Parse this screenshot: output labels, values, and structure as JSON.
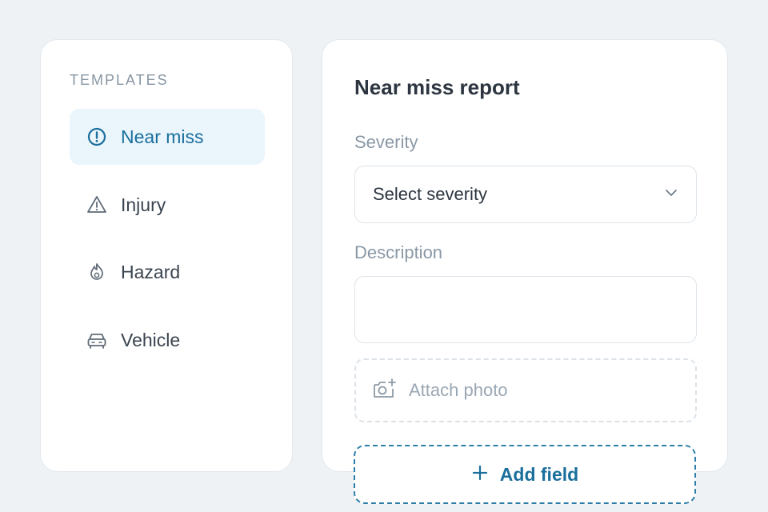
{
  "templates": {
    "heading": "TEMPLATES",
    "items": [
      {
        "label": "Near miss",
        "icon": "alert-circle-icon",
        "active": true
      },
      {
        "label": "Injury",
        "icon": "warning-triangle-icon",
        "active": false
      },
      {
        "label": "Hazard",
        "icon": "flame-icon",
        "active": false
      },
      {
        "label": "Vehicle",
        "icon": "car-icon",
        "active": false
      }
    ]
  },
  "form": {
    "title": "Near miss report",
    "severity_label": "Severity",
    "severity_value": "Select severity",
    "description_label": "Description",
    "description_value": "",
    "attach_label": "Attach photo",
    "add_field_label": "Add field"
  },
  "colors": {
    "accent": "#1b6f9c",
    "active_bg": "#eaf5fc",
    "page_bg": "#eef2f5"
  }
}
